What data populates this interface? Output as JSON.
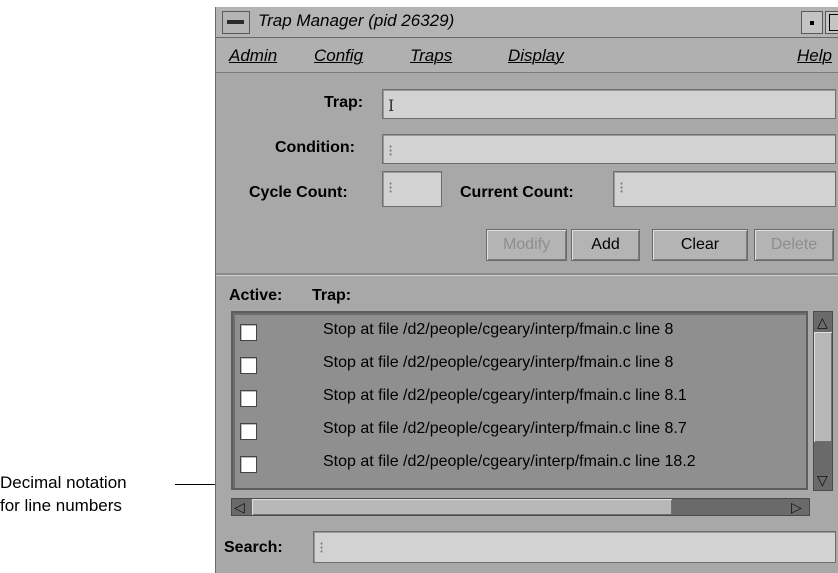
{
  "annotation": {
    "line1": "Decimal notation",
    "line2": "for line numbers"
  },
  "window": {
    "title": "Trap Manager (pid 26329)"
  },
  "menu": {
    "admin": "Admin",
    "config": "Config",
    "traps": "Traps",
    "display": "Display",
    "help": "Help"
  },
  "form": {
    "trap_label": "Trap:",
    "trap_value": "",
    "condition_label": "Condition:",
    "condition_value": "",
    "cycle_count_label": "Cycle Count:",
    "cycle_count_value": "",
    "current_count_label": "Current Count:",
    "current_count_value": ""
  },
  "buttons": {
    "modify": "Modify",
    "add": "Add",
    "clear": "Clear",
    "delete": "Delete"
  },
  "list": {
    "active_header": "Active:",
    "trap_header": "Trap:",
    "rows": [
      {
        "checked": false,
        "text": "Stop at file /d2/people/cgeary/interp/fmain.c line 8"
      },
      {
        "checked": false,
        "text": "Stop at file /d2/people/cgeary/interp/fmain.c line 8"
      },
      {
        "checked": false,
        "text": "Stop at file /d2/people/cgeary/interp/fmain.c line 8.1"
      },
      {
        "checked": false,
        "text": "Stop at file /d2/people/cgeary/interp/fmain.c line 8.7"
      },
      {
        "checked": false,
        "text": "Stop at file /d2/people/cgeary/interp/fmain.c line 18.2"
      }
    ]
  },
  "search": {
    "label": "Search:",
    "value": ""
  },
  "colors": {
    "window_bg": "#a8a8a8",
    "list_bg": "#8f8f8f",
    "field_bg": "#d2d2d2"
  }
}
